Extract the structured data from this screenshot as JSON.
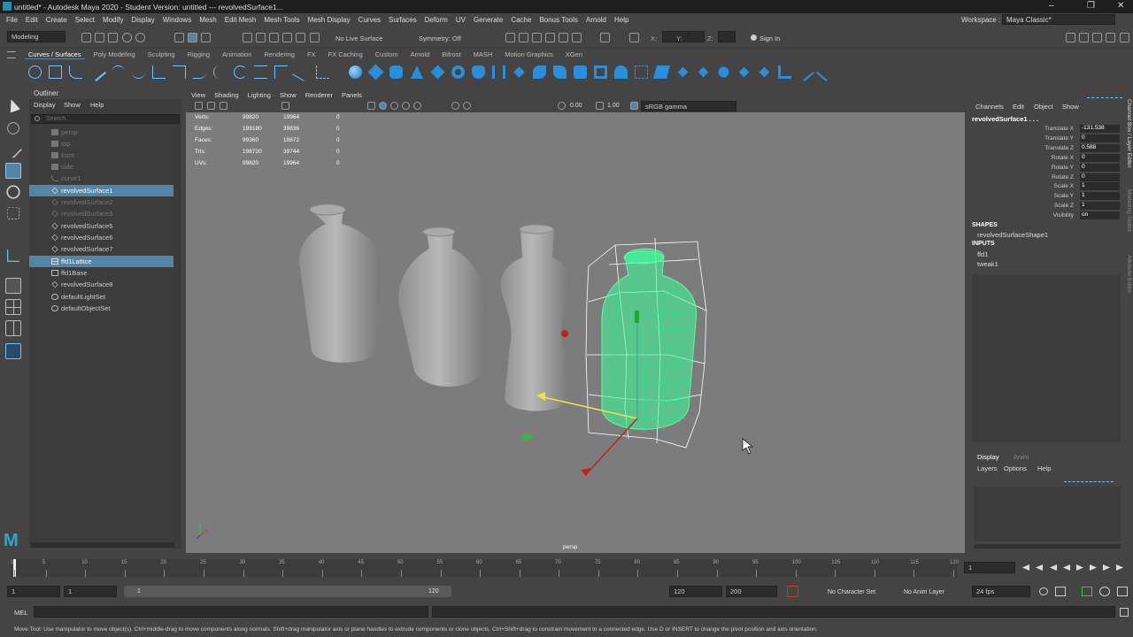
{
  "window": {
    "title": "untitled* - Autodesk Maya 2020 - Student Version: untitled   ---   revolvedSurface1...",
    "minimize": "–",
    "maximize": "❐",
    "close": "✕"
  },
  "menus": [
    "File",
    "Edit",
    "Create",
    "Select",
    "Modify",
    "Display",
    "Windows",
    "Mesh",
    "Edit Mesh",
    "Mesh Tools",
    "Mesh Display",
    "Curves",
    "Surfaces",
    "Deform",
    "UV",
    "Generate",
    "Cache",
    "Bonus Tools",
    "Arnold",
    "Help"
  ],
  "workspace": {
    "label": "Workspace :",
    "value": "Maya Classic*"
  },
  "status": {
    "mode": "Modeling",
    "live_surface": "No Live Surface",
    "symmetry": "Symmetry: Off",
    "x_label": "X:",
    "y_label": "Y:",
    "z_label": "Z:",
    "sign_in": "Sign In"
  },
  "shelf_tabs": [
    "Curves / Surfaces",
    "Poly Modeling",
    "Sculpting",
    "Rigging",
    "Animation",
    "Rendering",
    "FX",
    "FX Caching",
    "Custom",
    "Arnold",
    "Bifrost",
    "MASH",
    "Motion Graphics",
    "XGen"
  ],
  "outliner": {
    "title": "Outliner",
    "menus": [
      "Display",
      "Show",
      "Help"
    ],
    "search_placeholder": "Search...",
    "items": [
      {
        "label": "persp",
        "state": "dim",
        "icon": "camera-icon"
      },
      {
        "label": "top",
        "state": "dim",
        "icon": "camera-icon"
      },
      {
        "label": "front",
        "state": "dim",
        "icon": "camera-icon"
      },
      {
        "label": "side",
        "state": "dim",
        "icon": "camera-icon"
      },
      {
        "label": "curve1",
        "state": "dim",
        "icon": "curve-icon"
      },
      {
        "label": "revolvedSurface1",
        "state": "sel",
        "icon": "transform-icon"
      },
      {
        "label": "revolvedSurface2",
        "state": "dim",
        "icon": "transform-icon"
      },
      {
        "label": "revolvedSurface3",
        "state": "dim",
        "icon": "transform-icon"
      },
      {
        "label": "revolvedSurface5",
        "state": "",
        "icon": "transform-icon"
      },
      {
        "label": "revolvedSurface6",
        "state": "",
        "icon": "transform-icon"
      },
      {
        "label": "revolvedSurface7",
        "state": "",
        "icon": "transform-icon"
      },
      {
        "label": "ffd1Lattice",
        "state": "sel",
        "icon": "lattice-icon"
      },
      {
        "label": "ffd1Base",
        "state": "",
        "icon": "lattice-icon"
      },
      {
        "label": "revolvedSurface8",
        "state": "",
        "icon": "transform-icon"
      },
      {
        "label": "defaultLightSet",
        "state": "",
        "icon": "set-icon"
      },
      {
        "label": "defaultObjectSet",
        "state": "",
        "icon": "set-icon"
      }
    ]
  },
  "viewport": {
    "menus": [
      "View",
      "Shading",
      "Lighting",
      "Show",
      "Renderer",
      "Panels"
    ],
    "exposure": "0.00",
    "gamma": "1.00",
    "color_space": "sRGB gamma",
    "camera": "persp",
    "hud": [
      [
        "Verts:",
        "99820",
        "19964",
        "0"
      ],
      [
        "Edges:",
        "199180",
        "39836",
        "0"
      ],
      [
        "Faces:",
        "99360",
        "19872",
        "0"
      ],
      [
        "Tris:",
        "198720",
        "39744",
        "0"
      ],
      [
        "UVs:",
        "99820",
        "19964",
        "0"
      ]
    ]
  },
  "channel_box": {
    "menus": [
      "Channels",
      "Edit",
      "Object",
      "Show"
    ],
    "object": "revolvedSurface1 . . .",
    "attrs": [
      [
        "Translate X",
        "-131.538"
      ],
      [
        "Translate Y",
        "0"
      ],
      [
        "Translate Z",
        "0.588"
      ],
      [
        "Rotate X",
        "0"
      ],
      [
        "Rotate Y",
        "0"
      ],
      [
        "Rotate Z",
        "0"
      ],
      [
        "Scale X",
        "1"
      ],
      [
        "Scale Y",
        "1"
      ],
      [
        "Scale Z",
        "1"
      ],
      [
        "Visibility",
        "on"
      ]
    ],
    "shapes_label": "SHAPES",
    "shape": "revolvedSurfaceShape1",
    "inputs_label": "INPUTS",
    "inputs": [
      "ffd1",
      "tweak1"
    ],
    "side_tabs": [
      "Channel Box / Layer Editor",
      "Modelling Toolkit",
      "Attribute Editor"
    ]
  },
  "layer_editor": {
    "tabs": [
      "Display",
      "Anim"
    ],
    "menus": [
      "Layers",
      "Options",
      "Help"
    ]
  },
  "timeline": {
    "ticks": [
      "1",
      "5",
      "10",
      "15",
      "20",
      "25",
      "30",
      "35",
      "40",
      "45",
      "50",
      "55",
      "60",
      "65",
      "70",
      "75",
      "80",
      "85",
      "90",
      "95",
      "100",
      "105",
      "110",
      "115",
      "120"
    ],
    "current": "1"
  },
  "range": {
    "start": "1",
    "inner_start": "1",
    "slider_start": "1",
    "slider_end": "120",
    "end": "120",
    "max": "200",
    "character_set": "No Character Set",
    "anim_layer": "No Anim Layer",
    "fps": "24 fps"
  },
  "cmdline": {
    "label": "MEL"
  },
  "help_line": "Move Tool: Use manipulator to move object(s). Ctrl+middle-drag to move components along normals. Shift+drag manipulator axis or plane handles to extrude components or clone objects. Ctrl+Shift+drag to constrain movement to a connected edge. Use D or INSERT to change the pivot position and axis orientation.",
  "colors": {
    "selection": "#5285a6",
    "lattice": "#3cff9c",
    "wire": "#ffffff"
  }
}
